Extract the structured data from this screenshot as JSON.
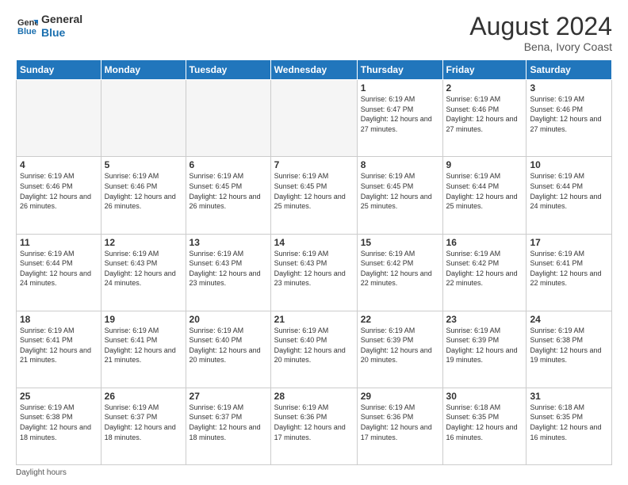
{
  "header": {
    "logo_line1": "General",
    "logo_line2": "Blue",
    "month_year": "August 2024",
    "location": "Bena, Ivory Coast"
  },
  "days_of_week": [
    "Sunday",
    "Monday",
    "Tuesday",
    "Wednesday",
    "Thursday",
    "Friday",
    "Saturday"
  ],
  "footer": {
    "label": "Daylight hours"
  },
  "weeks": [
    [
      {
        "day": "",
        "empty": true
      },
      {
        "day": "",
        "empty": true
      },
      {
        "day": "",
        "empty": true
      },
      {
        "day": "",
        "empty": true
      },
      {
        "day": "1",
        "sunrise": "Sunrise: 6:19 AM",
        "sunset": "Sunset: 6:47 PM",
        "daylight": "Daylight: 12 hours and 27 minutes."
      },
      {
        "day": "2",
        "sunrise": "Sunrise: 6:19 AM",
        "sunset": "Sunset: 6:46 PM",
        "daylight": "Daylight: 12 hours and 27 minutes."
      },
      {
        "day": "3",
        "sunrise": "Sunrise: 6:19 AM",
        "sunset": "Sunset: 6:46 PM",
        "daylight": "Daylight: 12 hours and 27 minutes."
      }
    ],
    [
      {
        "day": "4",
        "sunrise": "Sunrise: 6:19 AM",
        "sunset": "Sunset: 6:46 PM",
        "daylight": "Daylight: 12 hours and 26 minutes."
      },
      {
        "day": "5",
        "sunrise": "Sunrise: 6:19 AM",
        "sunset": "Sunset: 6:46 PM",
        "daylight": "Daylight: 12 hours and 26 minutes."
      },
      {
        "day": "6",
        "sunrise": "Sunrise: 6:19 AM",
        "sunset": "Sunset: 6:45 PM",
        "daylight": "Daylight: 12 hours and 26 minutes."
      },
      {
        "day": "7",
        "sunrise": "Sunrise: 6:19 AM",
        "sunset": "Sunset: 6:45 PM",
        "daylight": "Daylight: 12 hours and 25 minutes."
      },
      {
        "day": "8",
        "sunrise": "Sunrise: 6:19 AM",
        "sunset": "Sunset: 6:45 PM",
        "daylight": "Daylight: 12 hours and 25 minutes."
      },
      {
        "day": "9",
        "sunrise": "Sunrise: 6:19 AM",
        "sunset": "Sunset: 6:44 PM",
        "daylight": "Daylight: 12 hours and 25 minutes."
      },
      {
        "day": "10",
        "sunrise": "Sunrise: 6:19 AM",
        "sunset": "Sunset: 6:44 PM",
        "daylight": "Daylight: 12 hours and 24 minutes."
      }
    ],
    [
      {
        "day": "11",
        "sunrise": "Sunrise: 6:19 AM",
        "sunset": "Sunset: 6:44 PM",
        "daylight": "Daylight: 12 hours and 24 minutes."
      },
      {
        "day": "12",
        "sunrise": "Sunrise: 6:19 AM",
        "sunset": "Sunset: 6:43 PM",
        "daylight": "Daylight: 12 hours and 24 minutes."
      },
      {
        "day": "13",
        "sunrise": "Sunrise: 6:19 AM",
        "sunset": "Sunset: 6:43 PM",
        "daylight": "Daylight: 12 hours and 23 minutes."
      },
      {
        "day": "14",
        "sunrise": "Sunrise: 6:19 AM",
        "sunset": "Sunset: 6:43 PM",
        "daylight": "Daylight: 12 hours and 23 minutes."
      },
      {
        "day": "15",
        "sunrise": "Sunrise: 6:19 AM",
        "sunset": "Sunset: 6:42 PM",
        "daylight": "Daylight: 12 hours and 22 minutes."
      },
      {
        "day": "16",
        "sunrise": "Sunrise: 6:19 AM",
        "sunset": "Sunset: 6:42 PM",
        "daylight": "Daylight: 12 hours and 22 minutes."
      },
      {
        "day": "17",
        "sunrise": "Sunrise: 6:19 AM",
        "sunset": "Sunset: 6:41 PM",
        "daylight": "Daylight: 12 hours and 22 minutes."
      }
    ],
    [
      {
        "day": "18",
        "sunrise": "Sunrise: 6:19 AM",
        "sunset": "Sunset: 6:41 PM",
        "daylight": "Daylight: 12 hours and 21 minutes."
      },
      {
        "day": "19",
        "sunrise": "Sunrise: 6:19 AM",
        "sunset": "Sunset: 6:41 PM",
        "daylight": "Daylight: 12 hours and 21 minutes."
      },
      {
        "day": "20",
        "sunrise": "Sunrise: 6:19 AM",
        "sunset": "Sunset: 6:40 PM",
        "daylight": "Daylight: 12 hours and 20 minutes."
      },
      {
        "day": "21",
        "sunrise": "Sunrise: 6:19 AM",
        "sunset": "Sunset: 6:40 PM",
        "daylight": "Daylight: 12 hours and 20 minutes."
      },
      {
        "day": "22",
        "sunrise": "Sunrise: 6:19 AM",
        "sunset": "Sunset: 6:39 PM",
        "daylight": "Daylight: 12 hours and 20 minutes."
      },
      {
        "day": "23",
        "sunrise": "Sunrise: 6:19 AM",
        "sunset": "Sunset: 6:39 PM",
        "daylight": "Daylight: 12 hours and 19 minutes."
      },
      {
        "day": "24",
        "sunrise": "Sunrise: 6:19 AM",
        "sunset": "Sunset: 6:38 PM",
        "daylight": "Daylight: 12 hours and 19 minutes."
      }
    ],
    [
      {
        "day": "25",
        "sunrise": "Sunrise: 6:19 AM",
        "sunset": "Sunset: 6:38 PM",
        "daylight": "Daylight: 12 hours and 18 minutes."
      },
      {
        "day": "26",
        "sunrise": "Sunrise: 6:19 AM",
        "sunset": "Sunset: 6:37 PM",
        "daylight": "Daylight: 12 hours and 18 minutes."
      },
      {
        "day": "27",
        "sunrise": "Sunrise: 6:19 AM",
        "sunset": "Sunset: 6:37 PM",
        "daylight": "Daylight: 12 hours and 18 minutes."
      },
      {
        "day": "28",
        "sunrise": "Sunrise: 6:19 AM",
        "sunset": "Sunset: 6:36 PM",
        "daylight": "Daylight: 12 hours and 17 minutes."
      },
      {
        "day": "29",
        "sunrise": "Sunrise: 6:19 AM",
        "sunset": "Sunset: 6:36 PM",
        "daylight": "Daylight: 12 hours and 17 minutes."
      },
      {
        "day": "30",
        "sunrise": "Sunrise: 6:18 AM",
        "sunset": "Sunset: 6:35 PM",
        "daylight": "Daylight: 12 hours and 16 minutes."
      },
      {
        "day": "31",
        "sunrise": "Sunrise: 6:18 AM",
        "sunset": "Sunset: 6:35 PM",
        "daylight": "Daylight: 12 hours and 16 minutes."
      }
    ]
  ]
}
